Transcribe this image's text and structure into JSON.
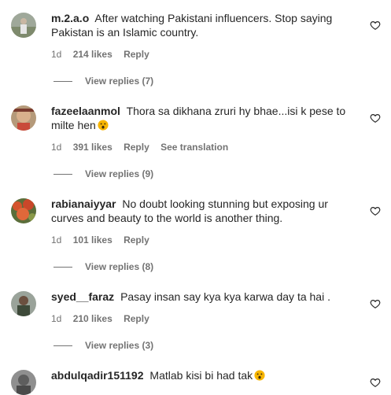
{
  "comments": [
    {
      "username": "m.2.a.o",
      "text": "After watching Pakistani influencers. Stop saying Pakistan is an Islamic country.",
      "time": "1d",
      "likes": "214 likes",
      "reply": "Reply",
      "view_replies": "View replies (7)"
    },
    {
      "username": "fazeelaanmol",
      "text": "Thora sa dikhana zruri hy bhae...isi k pese to milte hen",
      "emoji": "astonished-face",
      "time": "1d",
      "likes": "391 likes",
      "reply": "Reply",
      "translation": "See translation",
      "view_replies": "View replies (9)"
    },
    {
      "username": "rabianaiyyar",
      "text": "No doubt looking stunning but exposing ur curves and beauty to the world is another thing.",
      "time": "1d",
      "likes": "101 likes",
      "reply": "Reply",
      "view_replies": "View replies (8)"
    },
    {
      "username": "syed__faraz",
      "text": "Pasay insan say kya kya karwa day ta hai .",
      "time": "1d",
      "likes": "210 likes",
      "reply": "Reply",
      "view_replies": "View replies (3)"
    },
    {
      "username": "abdulqadir151192",
      "text": "Matlab kisi bi had tak",
      "emoji": "astonished-face"
    }
  ],
  "icons": {
    "like": "heart-outline-icon",
    "emoji_color": "#f7b500"
  }
}
